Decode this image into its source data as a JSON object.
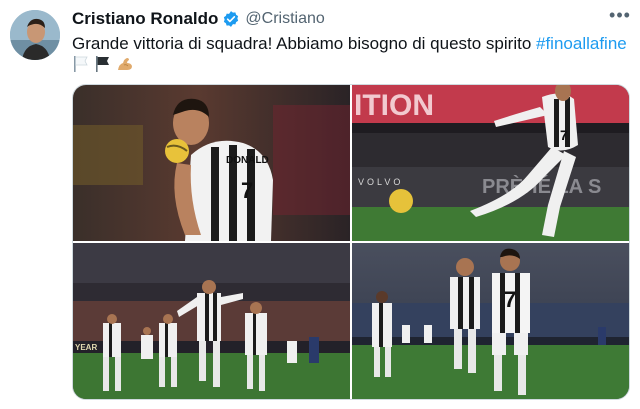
{
  "user": {
    "display_name": "Cristiano Ronaldo",
    "handle": "@Cristiano",
    "verified": true,
    "verified_color": "#1d9bf0"
  },
  "tweet": {
    "text": "Grande vittoria di squadra! Abbiamo bisogno di questo spirito ",
    "hashtag": "#finoallafine",
    "emojis": [
      "white-flag",
      "black-flag",
      "flexed-biceps"
    ],
    "more_label": "•••"
  },
  "media": {
    "photos": [
      {
        "name": "ronaldo-kissing-ball",
        "ad_text": ""
      },
      {
        "name": "free-kick",
        "ad_text_top": "ITION",
        "ad_text_mid": "VOLVO",
        "ad_text_right": "PRÈHÉ LA S"
      },
      {
        "name": "team-celebration",
        "ad_text": "YEAR"
      },
      {
        "name": "players-walking",
        "ad_text": ""
      }
    ]
  },
  "colors": {
    "text": "#0f1419",
    "secondary": "#536471",
    "link": "#1d9bf0",
    "border": "#cfd9de"
  }
}
